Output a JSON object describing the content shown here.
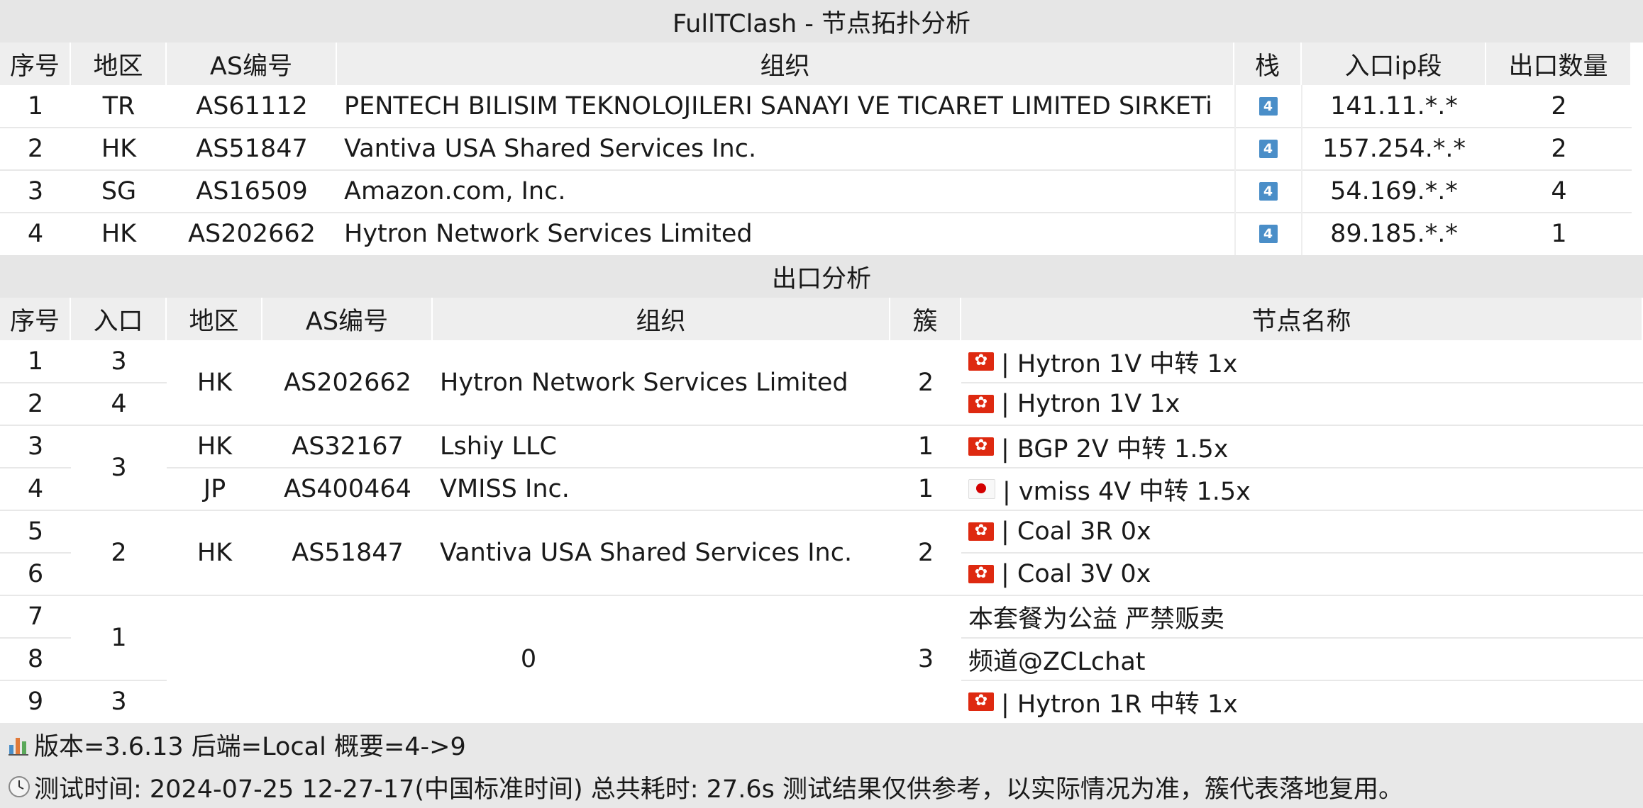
{
  "title": "FullTClash - 节点拓扑分析",
  "inbound": {
    "headers": [
      "序号",
      "地区",
      "AS编号",
      "组织",
      "栈",
      "入口ip段",
      "出口数量"
    ],
    "rows": [
      {
        "no": "1",
        "region": "TR",
        "asn": "AS61112",
        "org": "PENTECH BILISIM TEKNOLOJILERI SANAYI VE TICARET LIMITED SIRKETi",
        "stack": "4",
        "ip": "141.11.*.*",
        "count": "2"
      },
      {
        "no": "2",
        "region": "HK",
        "asn": "AS51847",
        "org": "Vantiva USA Shared Services Inc.",
        "stack": "4",
        "ip": "157.254.*.*",
        "count": "2"
      },
      {
        "no": "3",
        "region": "SG",
        "asn": "AS16509",
        "org": "Amazon.com, Inc.",
        "stack": "4",
        "ip": "54.169.*.*",
        "count": "4"
      },
      {
        "no": "4",
        "region": "HK",
        "asn": "AS202662",
        "org": "Hytron Network Services Limited",
        "stack": "4",
        "ip": "89.185.*.*",
        "count": "1"
      }
    ]
  },
  "outbound": {
    "title": "出口分析",
    "headers": [
      "序号",
      "入口",
      "地区",
      "AS编号",
      "组织",
      "簇",
      "节点名称"
    ],
    "numbers": [
      "1",
      "2",
      "3",
      "4",
      "5",
      "6",
      "7",
      "8",
      "9"
    ],
    "entries": [
      "3",
      "4",
      "3",
      "2",
      "1",
      "3"
    ],
    "groups": [
      {
        "region": "HK",
        "asn": "AS202662",
        "org": "Hytron Network Services Limited",
        "cluster": "2"
      },
      {
        "region": "HK",
        "asn": "AS32167",
        "org": "Lshiy LLC",
        "cluster": "1"
      },
      {
        "region": "JP",
        "asn": "AS400464",
        "org": "VMISS Inc.",
        "cluster": "1"
      },
      {
        "region": "HK",
        "asn": "AS51847",
        "org": "Vantiva USA Shared Services Inc.",
        "cluster": "2"
      },
      {
        "region": "",
        "asn": "0",
        "org": "",
        "cluster": "3"
      }
    ],
    "nodes": [
      {
        "flag": "hk-flag-icon",
        "name": "| Hytron 1V 中转 1x"
      },
      {
        "flag": "hk-flag-icon",
        "name": "| Hytron 1V 1x"
      },
      {
        "flag": "hk-flag-icon",
        "name": "| BGP 2V 中转 1.5x"
      },
      {
        "flag": "jp-flag-icon",
        "name": "| vmiss 4V 中转 1.5x"
      },
      {
        "flag": "hk-flag-icon",
        "name": "| Coal 3R 0x"
      },
      {
        "flag": "hk-flag-icon",
        "name": "| Coal 3V 0x"
      },
      {
        "flag": "",
        "name": "本套餐为公益 严禁贩卖"
      },
      {
        "flag": "",
        "name": "频道@ZCLchat"
      },
      {
        "flag": "hk-flag-icon",
        "name": "| Hytron 1R 中转 1x"
      }
    ]
  },
  "footer": {
    "version_line": "版本=3.6.13  后端=Local  概要=4->9",
    "time_line": "测试时间: 2024-07-25 12-27-17(中国标准时间) 总共耗时: 27.6s 测试结果仅供参考，以实际情况为准，簇代表落地复用。"
  },
  "colors": {
    "header_bg": "#eeeeee",
    "title_bg": "#e6e6e6",
    "stack_badge": "#4a8ec8",
    "hk_flag": "#de2910",
    "jp_dot": "#d30000"
  }
}
